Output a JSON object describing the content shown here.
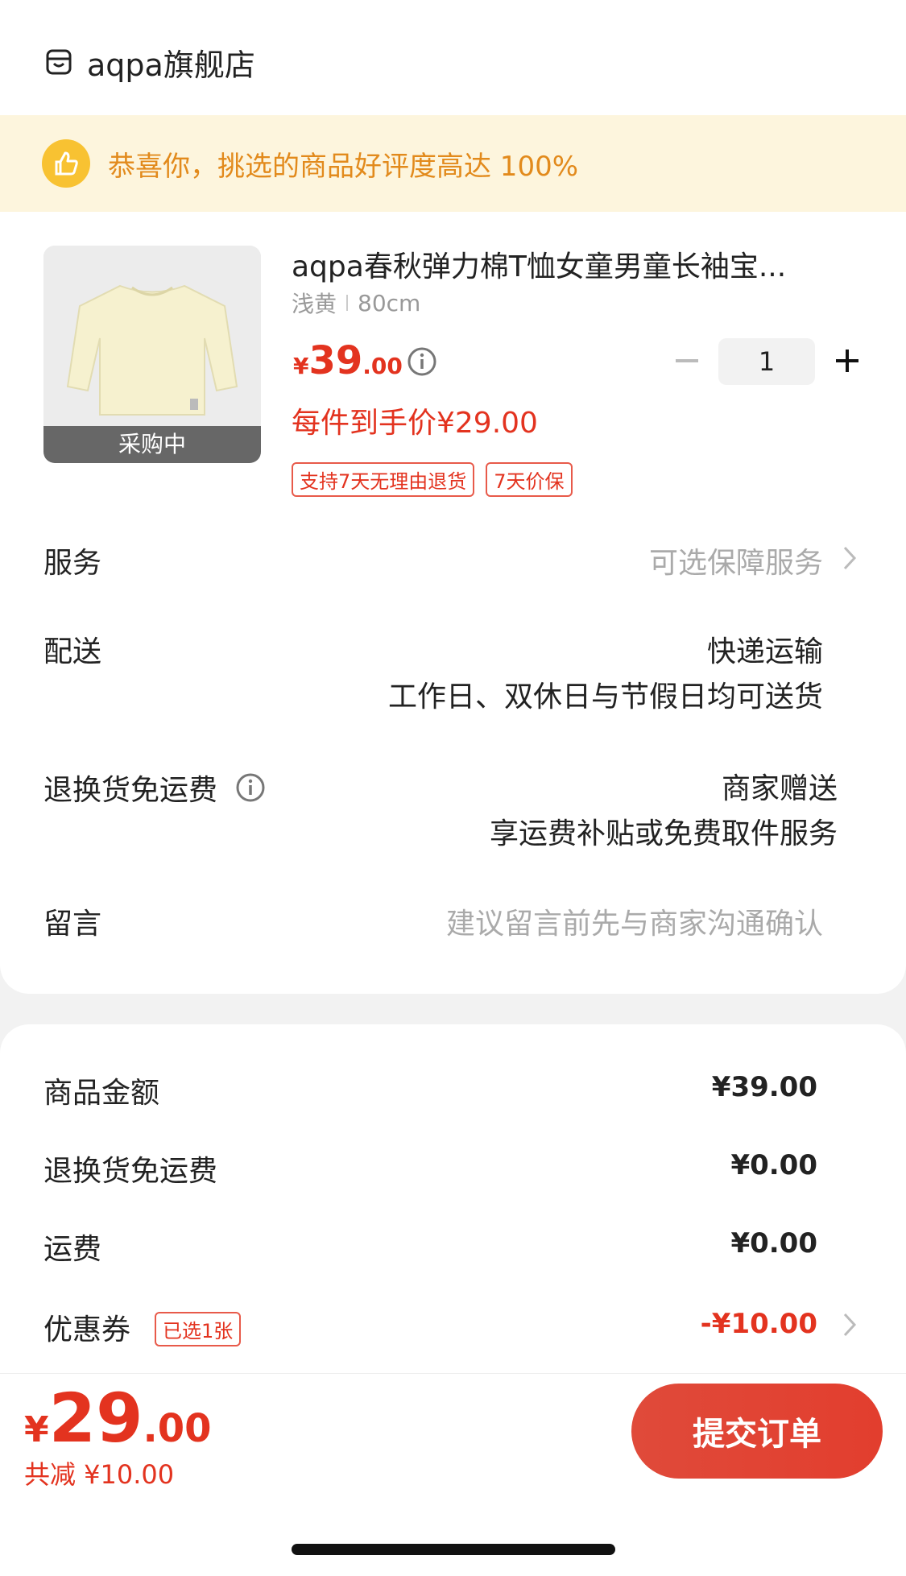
{
  "store": {
    "name": "aqpa旗舰店",
    "icon": "store-icon"
  },
  "banner": {
    "text": "恭喜你，挑选的商品好评度高达 100%",
    "icon": "thumbs-up-icon",
    "accent": "#e28a1c"
  },
  "product": {
    "status_label": "采购中",
    "title": "aqpa春秋弹力棉T恤女童男童长袖宝...",
    "spec_color": "浅黄",
    "spec_size": "80cm",
    "price_symbol": "¥",
    "price_int": "39",
    "price_dec": ".00",
    "unit_price": "每件到手价¥29.00",
    "tags": [
      "支持7天无理由退货",
      "7天价保"
    ],
    "quantity": "1",
    "price_color": "#e3331f"
  },
  "rows": {
    "service": {
      "label": "服务",
      "value": "可选保障服务"
    },
    "delivery": {
      "label": "配送",
      "value1": "快递运输",
      "value2": "工作日、双休日与节假日均可送货"
    },
    "return_shipping": {
      "label": "退换货免运费",
      "value1": "商家赠送",
      "value2": "享运费补贴或免费取件服务"
    },
    "message": {
      "label": "留言",
      "placeholder": "建议留言前先与商家沟通确认"
    }
  },
  "summary": {
    "goods_amount": {
      "label": "商品金额",
      "value": "¥39.00"
    },
    "return_fee": {
      "label": "退换货免运费",
      "value": "¥0.00"
    },
    "shipping": {
      "label": "运费",
      "value": "¥0.00"
    },
    "coupon": {
      "label": "优惠券",
      "tag": "已选1张",
      "value": "-¥10.00"
    }
  },
  "footer": {
    "total_symbol": "¥",
    "total_int": "29",
    "total_dec": ".00",
    "saved": "共减 ¥10.00",
    "submit_label": "提交订单"
  }
}
